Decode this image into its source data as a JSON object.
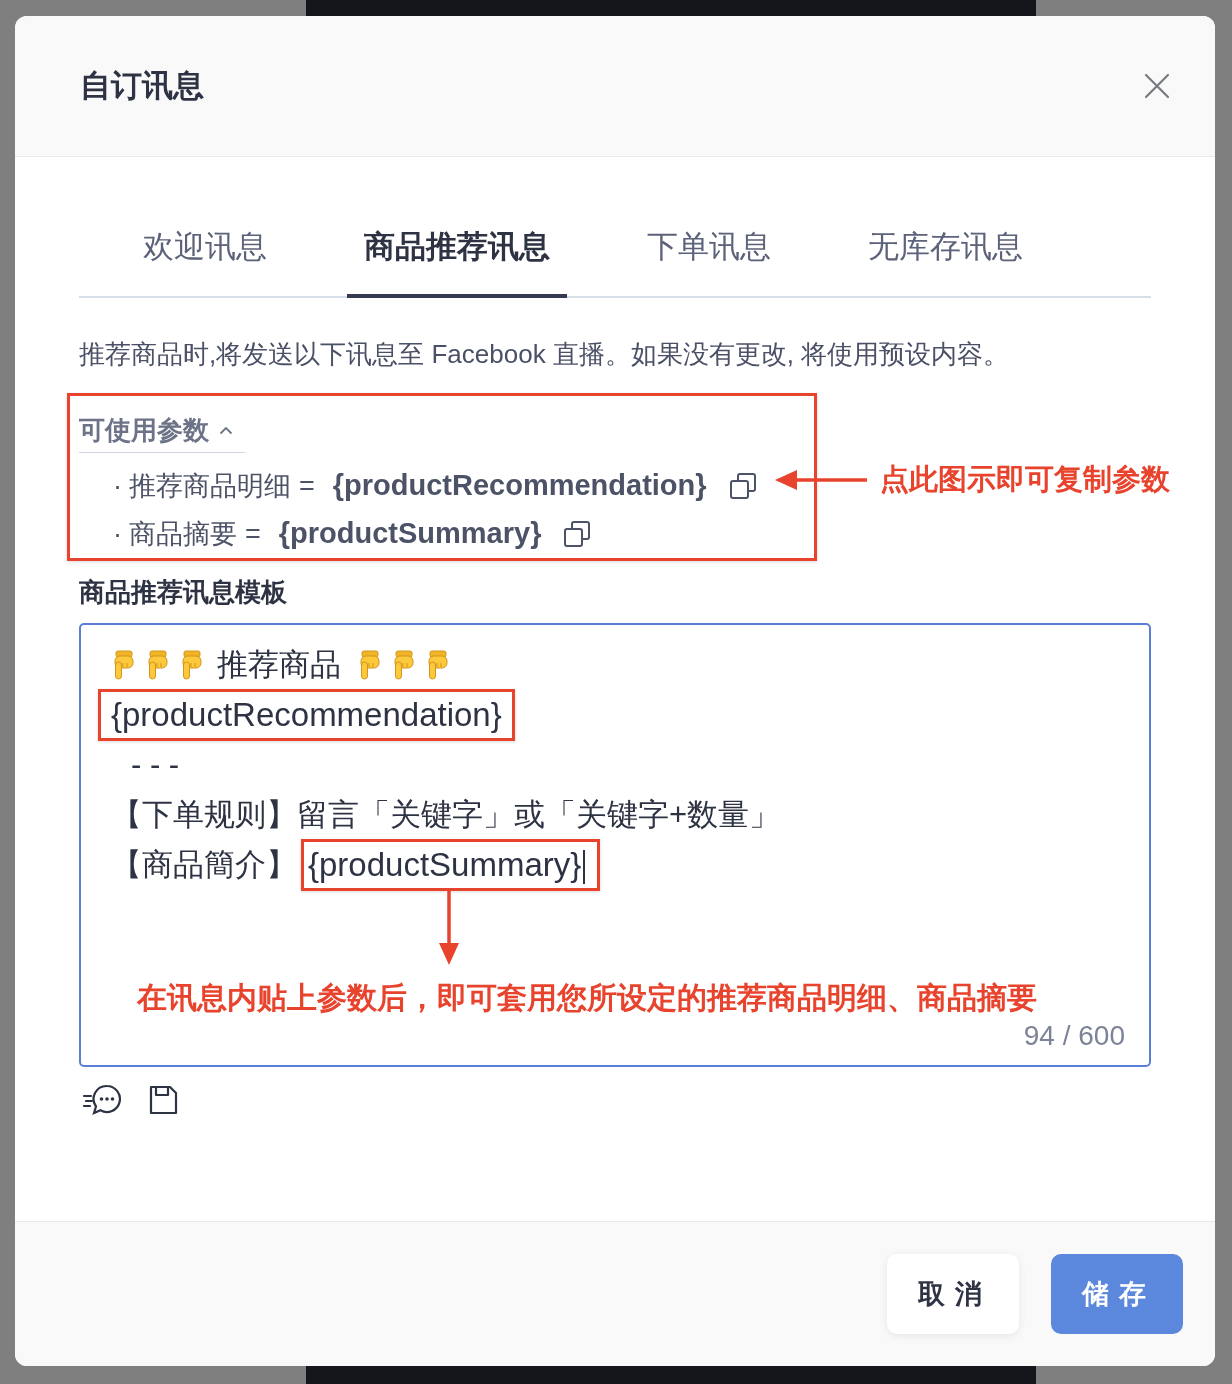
{
  "dialog": {
    "title": "自订讯息"
  },
  "tabs": [
    {
      "label": "欢迎讯息",
      "selected": false
    },
    {
      "label": "商品推荐讯息",
      "selected": true
    },
    {
      "label": "下单讯息",
      "selected": false
    },
    {
      "label": "无库存讯息",
      "selected": false
    }
  ],
  "description": "推荐商品时,将发送以下讯息至 Facebook 直播。如果没有更改, 将使用预设内容。",
  "parameters": {
    "title": "可使用参数",
    "expanded": true,
    "items": [
      {
        "label": "· 推荐商品明细 =",
        "token": "{productRecommendation}"
      },
      {
        "label": "· 商品摘要 =",
        "token": "{productSummary}"
      }
    ],
    "annotation": {
      "text": "点此图示即可复制参数"
    }
  },
  "template": {
    "label": "商品推荐讯息模板",
    "focused": true,
    "lines": [
      {
        "kind": "heading",
        "segments": [
          {
            "text": "推荐商品",
            "highlighted": false
          }
        ]
      },
      {
        "kind": "plain",
        "segments": [
          {
            "text": "{productRecommendation}",
            "highlighted": true
          }
        ]
      },
      {
        "kind": "separator",
        "segments": [
          {
            "text": "- - -",
            "highlighted": false
          }
        ]
      },
      {
        "kind": "plain",
        "segments": [
          {
            "text": "【下单规则】留言「关键字」或「关键字+数量」",
            "highlighted": false
          }
        ]
      },
      {
        "kind": "plain",
        "segments": [
          {
            "text": "【商品簡介】",
            "highlighted": false
          },
          {
            "text": "{productSummary}",
            "highlighted": true
          }
        ]
      }
    ],
    "annotation": {
      "text": "在讯息内贴上参数后，即可套用您所设定的推荐商品明细、商品摘要"
    },
    "counter": "94 / 600"
  },
  "footer": {
    "buttons": [
      {
        "label": "取消",
        "kind": "secondary"
      },
      {
        "label": "储存",
        "kind": "primary"
      }
    ]
  }
}
